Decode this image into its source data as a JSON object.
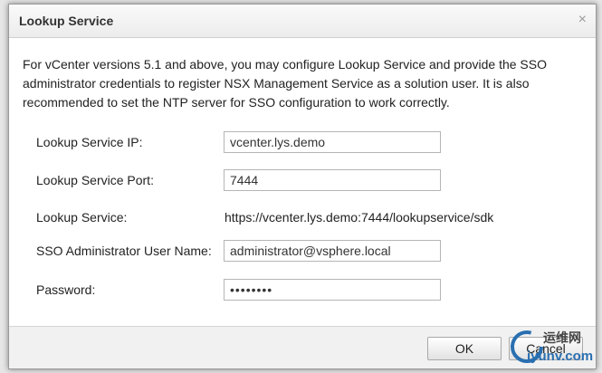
{
  "dialog": {
    "title": "Lookup Service",
    "close_label": "×",
    "intro": "For vCenter versions 5.1 and above, you may configure Lookup Service and provide the SSO administrator credentials to register NSX Management Service as a solution user. It is also recommended to set the NTP server for SSO configuration to work correctly."
  },
  "form": {
    "ip_label": "Lookup Service IP:",
    "ip_value": "vcenter.lys.demo",
    "port_label": "Lookup Service Port:",
    "port_value": "7444",
    "service_label": "Lookup Service:",
    "service_value": "https://vcenter.lys.demo:7444/lookupservice/sdk",
    "user_label": "SSO Administrator User Name:",
    "user_value": "administrator@vsphere.local",
    "password_label": "Password:",
    "password_value": "••••••••"
  },
  "buttons": {
    "ok": "OK",
    "cancel": "Cancel"
  },
  "watermark": {
    "line1": "运维网",
    "line2": "iyunv.com"
  }
}
